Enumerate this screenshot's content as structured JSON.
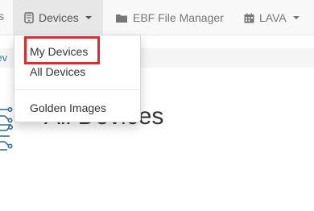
{
  "navbar": {
    "edge_fragment": "s",
    "devices_label": "Devices",
    "ebf_label": "EBF File Manager",
    "lava_label": "LAVA"
  },
  "breadcrumb": {
    "fragment": "Dev"
  },
  "page": {
    "title": "All Devices"
  },
  "dropdown": {
    "items": [
      {
        "label": "My Devices",
        "highlighted": true
      },
      {
        "label": "All Devices"
      },
      {
        "label": "Golden Images"
      }
    ]
  },
  "colors": {
    "highlight": "#e8262b",
    "link": "#337ab7",
    "navbar": "#f8f8f8",
    "active_nav": "#e7e7e7"
  },
  "icons": [
    "device-icon",
    "folder-icon",
    "calendar-icon",
    "chip-icon",
    "caret-down-icon"
  ]
}
